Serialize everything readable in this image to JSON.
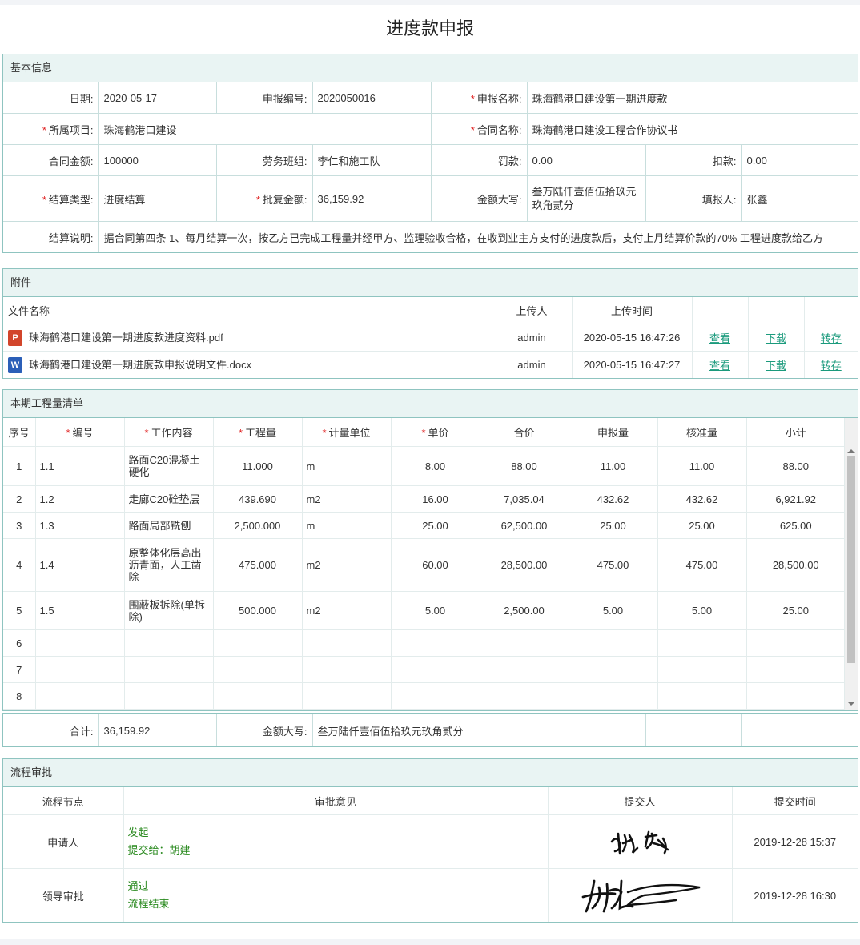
{
  "page_title": "进度款申报",
  "basic": {
    "header": "基本信息",
    "date_label": "日期:",
    "date_value": "2020-05-17",
    "code_label": "申报编号:",
    "code_value": "2020050016",
    "name_label": "申报名称:",
    "name_value": "珠海鹤港口建设第一期进度款",
    "project_label": "所属项目:",
    "project_value": "珠海鹤港口建设",
    "contract_label": "合同名称:",
    "contract_value": "珠海鹤港口建设工程合作协议书",
    "amount_label": "合同金额:",
    "amount_value": "100000",
    "team_label": "劳务班组:",
    "team_value": "李仁和施工队",
    "fine_label": "罚款:",
    "fine_value": "0.00",
    "deduct_label": "扣款:",
    "deduct_value": "0.00",
    "settle_type_label": "结算类型:",
    "settle_type_value": "进度结算",
    "approved_label": "批复金额:",
    "approved_value": "36,159.92",
    "upper_label": "金额大写:",
    "upper_value": "叁万陆仟壹佰伍拾玖元玖角贰分",
    "filler_label": "填报人:",
    "filler_value": "张鑫",
    "desc_label": "结算说明:",
    "desc_value": "据合同第四条 1、每月结算一次，按乙方已完成工程量并经甲方、监理验收合格，在收到业主方支付的进度款后，支付上月结算价款的70% 工程进度款给乙方"
  },
  "attach": {
    "header": "附件",
    "col_name": "文件名称",
    "col_uploader": "上传人",
    "col_time": "上传时间",
    "files": [
      {
        "icon": "pdf-file-icon",
        "badge": "P",
        "name": "珠海鹤港口建设第一期进度款进度资料.pdf",
        "uploader": "admin",
        "time": "2020-05-15 16:47:26",
        "view": "查看",
        "download": "下载",
        "transfer": "转存"
      },
      {
        "icon": "word-file-icon",
        "badge": "W",
        "name": "珠海鹤港口建设第一期进度款申报说明文件.docx",
        "uploader": "admin",
        "time": "2020-05-15 16:47:27",
        "view": "查看",
        "download": "下载",
        "transfer": "转存"
      }
    ]
  },
  "bill": {
    "header": "本期工程量清单",
    "columns": [
      "序号",
      "编号",
      "工作内容",
      "工程量",
      "计量单位",
      "单价",
      "合价",
      "申报量",
      "核准量",
      "小计"
    ],
    "rows": [
      {
        "no": "1",
        "code": "1.1",
        "content": "路面C20混凝土硬化",
        "qty": "11.000",
        "unit": "m",
        "price": "8.00",
        "total": "88.00",
        "declared": "11.00",
        "approved": "11.00",
        "subtotal": "88.00"
      },
      {
        "no": "2",
        "code": "1.2",
        "content": "走廊C20砼垫层",
        "qty": "439.690",
        "unit": "m2",
        "price": "16.00",
        "total": "7,035.04",
        "declared": "432.62",
        "approved": "432.62",
        "subtotal": "6,921.92"
      },
      {
        "no": "3",
        "code": "1.3",
        "content": "路面局部铣刨",
        "qty": "2,500.000",
        "unit": "m",
        "price": "25.00",
        "total": "62,500.00",
        "declared": "25.00",
        "approved": "25.00",
        "subtotal": "625.00"
      },
      {
        "no": "4",
        "code": "1.4",
        "content": "原整体化层高出沥青面，人工凿除",
        "qty": "475.000",
        "unit": "m2",
        "price": "60.00",
        "total": "28,500.00",
        "declared": "475.00",
        "approved": "475.00",
        "subtotal": "28,500.00"
      },
      {
        "no": "5",
        "code": "1.5",
        "content": "围蔽板拆除(单拆除)",
        "qty": "500.000",
        "unit": "m2",
        "price": "5.00",
        "total": "2,500.00",
        "declared": "5.00",
        "approved": "5.00",
        "subtotal": "25.00"
      },
      {
        "no": "6",
        "code": "",
        "content": "",
        "qty": "",
        "unit": "",
        "price": "",
        "total": "",
        "declared": "",
        "approved": "",
        "subtotal": ""
      },
      {
        "no": "7",
        "code": "",
        "content": "",
        "qty": "",
        "unit": "",
        "price": "",
        "total": "",
        "declared": "",
        "approved": "",
        "subtotal": ""
      },
      {
        "no": "8",
        "code": "",
        "content": "",
        "qty": "",
        "unit": "",
        "price": "",
        "total": "",
        "declared": "",
        "approved": "",
        "subtotal": ""
      }
    ],
    "sum_label": "合计:",
    "sum_value": "36,159.92",
    "sum_upper_label": "金额大写:",
    "sum_upper_value": "叁万陆仟壹佰伍拾玖元玖角贰分"
  },
  "flow": {
    "header": "流程审批",
    "col_node": "流程节点",
    "col_opinion": "审批意见",
    "col_submitter": "提交人",
    "col_time": "提交时间",
    "rows": [
      {
        "node": "申请人",
        "op1": "发起",
        "op2": "提交给：胡建",
        "signature": "张鑫",
        "time": "2019-12-28 15:37"
      },
      {
        "node": "领导审批",
        "op1": "通过",
        "op2": "流程结束",
        "signature": "胡建",
        "time": "2019-12-28 16:30"
      }
    ]
  }
}
